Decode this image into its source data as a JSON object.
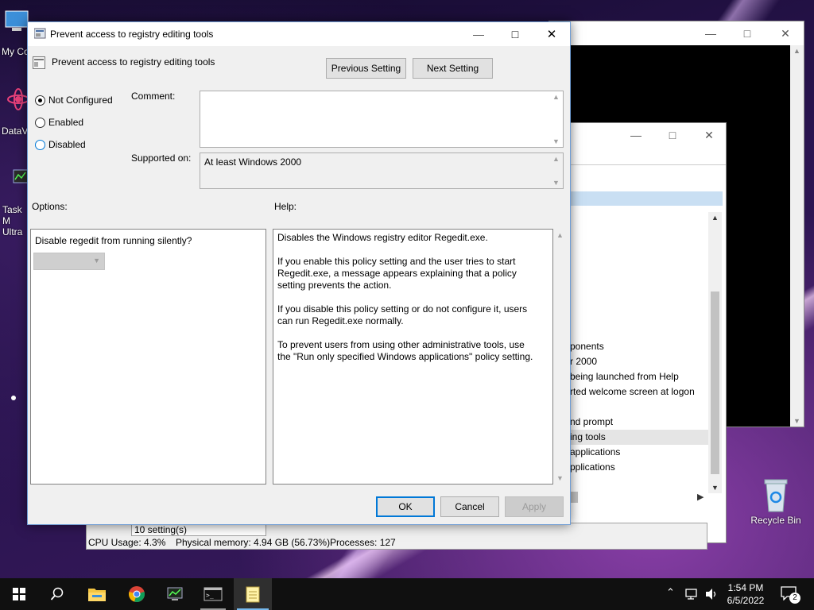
{
  "desktop": {
    "icons": [
      {
        "label": "My Co",
        "name": "my-computer"
      },
      {
        "label": "DataV",
        "name": "datav"
      },
      {
        "label": "Task M Ultra",
        "name": "task-manager-ultra"
      },
      {
        "label": "Recycle Bin",
        "name": "recycle-bin"
      }
    ]
  },
  "background_windows": {
    "policy_list": [
      "ponents",
      "r 2000",
      "being launched from Help",
      "rted welcome screen at logon",
      "nd prompt",
      "ing tools",
      "applications",
      "pplications"
    ],
    "task_manager": {
      "status": "10 setting(s)",
      "cpu": "CPU Usage: 4.3%",
      "memory": "Physical memory: 4.94 GB (56.73%)",
      "processes": "Processes: 127"
    }
  },
  "dialog": {
    "title": "Prevent access to registry editing tools",
    "header_title": "Prevent access to registry editing tools",
    "previous_setting": "Previous Setting",
    "next_setting": "Next Setting",
    "radio": {
      "not_configured": "Not Configured",
      "enabled": "Enabled",
      "disabled": "Disabled",
      "selected": "Not Configured"
    },
    "comment_label": "Comment:",
    "comment_value": "",
    "supported_on_label": "Supported on:",
    "supported_on_value": "At least Windows 2000",
    "options_label": "Options:",
    "help_label": "Help:",
    "option_question": "Disable regedit from running silently?",
    "option_dropdown_value": "",
    "help_text": [
      "Disables the Windows registry editor Regedit.exe.",
      "If you enable this policy setting and the user tries to start Regedit.exe, a message appears explaining that a policy setting prevents the action.",
      "If you disable this policy setting or do not configure it, users can run Regedit.exe normally.",
      "To prevent users from using other administrative tools, use the \"Run only specified Windows applications\" policy setting."
    ],
    "ok": "OK",
    "cancel": "Cancel",
    "apply": "Apply"
  },
  "taskbar": {
    "time": "1:54 PM",
    "date": "6/5/2022",
    "notification_count": "2",
    "apps": [
      "start",
      "search",
      "file-explorer",
      "chrome",
      "task-manager",
      "command-prompt",
      "notepad"
    ]
  },
  "colors": {
    "accent": "#0078d7",
    "taskbar": "#101010",
    "dialog_bg": "#f0f0f0"
  }
}
